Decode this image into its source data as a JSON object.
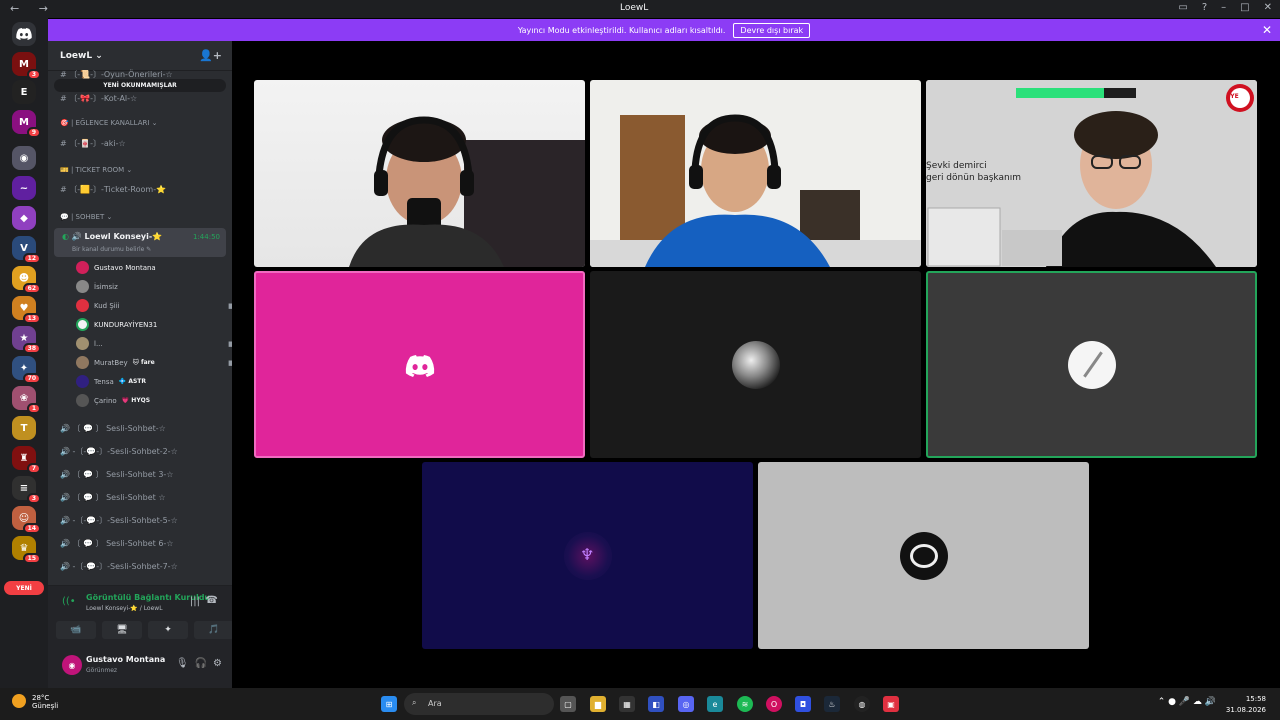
{
  "window": {
    "title": "LoewL",
    "nav": "←  →"
  },
  "banner": {
    "text": "Yayıncı Modu etkinleştirildi. Kullanıcı adları kısaltıldı.",
    "button": "Devre dışı bırak"
  },
  "servers": {
    "badges": [
      "3",
      "9",
      "12",
      "62",
      "13",
      "38",
      "70",
      "1",
      "7",
      "3",
      "14",
      "15"
    ],
    "new_label": "YENİ"
  },
  "guild": {
    "name": "LoewL",
    "unread_pill": "YENİ OKUNMAMIŞLAR",
    "channels_top": [
      "〔-📜-〕-Oyun-Önerileri-☆",
      "〔-🎀-〕-Kot-Al-☆"
    ],
    "category_fun": "| EĞLENCE KANALLARI",
    "channel_aki": "〔-🀄-〕-aki-☆",
    "category_ticket": "| TICKET ROOM",
    "channel_ticket": "〔-🟨-〕-Ticket-Room-⭐",
    "category_chat": "| SOHBET",
    "active_voice": {
      "name": "Loewl Konseyi-⭐",
      "time": "1:44:50",
      "sub": "Bir kanal durumu belirle ✎"
    },
    "members": [
      {
        "name": "Gustavo Montana",
        "tag": "",
        "bold": true
      },
      {
        "name": "İsimsiz",
        "tag": ""
      },
      {
        "name": "Kud Şiii",
        "tag": ""
      },
      {
        "name": "KUNDURAYİYEN31",
        "tag": "",
        "bold": true
      },
      {
        "name": "l...",
        "tag": ""
      },
      {
        "name": "MuratBey",
        "tag": "🐱 fare"
      },
      {
        "name": "Tensa",
        "tag": "💠 ASTR"
      },
      {
        "name": "Çarino",
        "tag": "💗 HYQS"
      }
    ],
    "voice_channels": [
      "〔 💬 〕 Sesli-Sohbet-☆",
      "-〔-💬-〕-Sesli-Sohbet-2-☆",
      "〔 💬 〕 Sesli-Sohbet 3-☆",
      "〔 💬 〕 Sesli-Sohbet ☆",
      "-〔-💬-〕-Sesli-Sohbet-5-☆",
      "〔 💬 〕 Sesli-Sohbet 6-☆",
      "-〔-💬-〕-Sesli-Sohbet-7-☆"
    ]
  },
  "rtc": {
    "status": "Görüntülü Bağlantı Kuruldu",
    "sub": "Loewl Konseyi-⭐ / LoewL",
    "buttons": [
      "📹",
      "🖥",
      "✦",
      "🎵"
    ]
  },
  "user": {
    "name": "Gustavo Montana",
    "status": "Görünmez"
  },
  "stage": {
    "tile3_overlay_line1": "Şevki demirci",
    "tile3_overlay_line2": "geri dönün başkanım",
    "tile3_badge": "BYE"
  },
  "taskbar": {
    "temp": "28°C",
    "weather": "Güneşli",
    "search": "Ara",
    "time": "15:58",
    "date": "31.08.2026",
    "tray": "⌃  ●  🎤  ☁  🔊"
  },
  "colors": {
    "discord_blurple": "#5865f2",
    "speaking_green": "#23a55a",
    "banner_purple": "#8c3cf5",
    "pink_tile": "#e0259a"
  }
}
